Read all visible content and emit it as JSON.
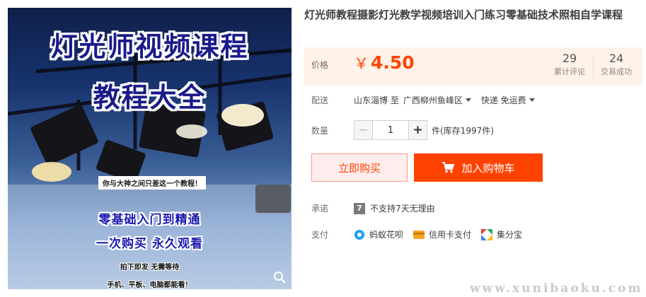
{
  "product": {
    "title": "灯光师教程摄影灯光教学视频培训入门练习零基础技术照相自学课程",
    "image": {
      "headline_1": "灯光师视频课程",
      "headline_2": "教程大全",
      "banner": "你与大神之间只差这一个教程！",
      "line_1": "零基础入门到精通",
      "line_2": "一次购买  永久观看",
      "small_1": "拍下即发  无需等待",
      "small_2": "手机、平板、电脑都能看！",
      "zoom_icon": "magnifier-icon"
    }
  },
  "price": {
    "label": "价格",
    "currency": "￥",
    "value": "4.50",
    "reviews_count": "29",
    "reviews_label": "累计评论",
    "sold_count": "24",
    "sold_label": "交易成功"
  },
  "delivery": {
    "label": "配送",
    "from": "山东淄博 至",
    "to": "广西柳州鱼峰区",
    "method": "快递 免运费"
  },
  "quantity": {
    "label": "数量",
    "minus": "−",
    "value": "1",
    "plus": "+",
    "stock_text": "件(库存1997件)"
  },
  "actions": {
    "buy_now": "立即购买",
    "add_to_cart": "加入购物车"
  },
  "promise": {
    "label": "承诺",
    "badge": "7",
    "text": "不支持7天无理由"
  },
  "payment": {
    "label": "支付",
    "methods": [
      "蚂蚁花呗",
      "信用卡支付",
      "集分宝"
    ]
  },
  "watermark": "www.xunibaoku.com",
  "colors": {
    "accent": "#ff4200",
    "price_bg": "#fff2e8",
    "buy_bg": "#ffeded"
  }
}
